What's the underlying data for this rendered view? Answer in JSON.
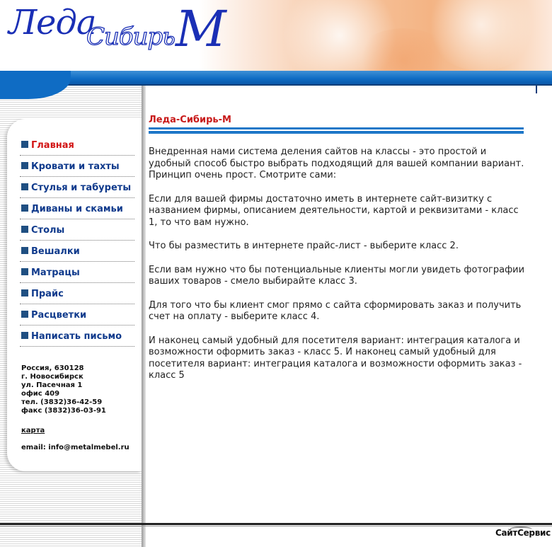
{
  "header": {
    "logo_part1": "Леда",
    "logo_part2": "Сибирь",
    "logo_part3": "М"
  },
  "sidebar": {
    "items": [
      {
        "label": "Главная",
        "active": true
      },
      {
        "label": "Кровати и тахты"
      },
      {
        "label": "Стулья и табуреты"
      },
      {
        "label": "Диваны и скамьи"
      },
      {
        "label": "Столы"
      },
      {
        "label": "Вешалки"
      },
      {
        "label": "Матрацы"
      },
      {
        "label": "Прайс"
      },
      {
        "label": "Расцветки"
      },
      {
        "label": "Написать письмо"
      }
    ],
    "contact": {
      "line1": "Россия, 630128",
      "line2": "г. Новосибирск",
      "line3": "ул. Пасечная 1",
      "line4": "офис 409",
      "phone": "тел. (3832)36-42-59",
      "fax": "факс (3832)36-03-91",
      "map_link": "карта",
      "email": "email: info@metalmebel.ru"
    }
  },
  "main": {
    "title": "Леда-Сибирь-М",
    "paragraphs": [
      "Внедренная нами система деления сайтов на классы - это простой и удобный способ быстро выбрать подходящий для вашей компании вариант. Принцип очень прост. Смотрите сами:",
      "Если для вашей фирмы достаточно иметь в интернете сайт-визитку с названием фирмы, описанием деятельности, картой и реквизитами - класс 1, то что вам нужно.",
      "Что бы разместить в интернете прайс-лист - выберите класс 2.",
      "Если вам нужно что бы потенциальные клиенты могли увидеть фотографии ваших товаров - смело выбирайте класс 3.",
      "Для того что бы клиент смог прямо с сайта сформировать заказ и получить счет на оплату - выберите класс 4.",
      "И наконец самый удобный для посетителя вариант: интеграция каталога и возможности оформить заказ - класс 5. И наконец самый удобный для посетителя вариант: интеграция каталога и возможности оформить заказ - класс 5"
    ]
  },
  "footer": {
    "credit": "СайтСервис"
  },
  "colors": {
    "brand_blue": "#1a2fb5",
    "band_blue": "#0f6cc4",
    "menu_text": "#0f3a8c",
    "active_text": "#d21414",
    "title_red": "#c81a1a"
  }
}
